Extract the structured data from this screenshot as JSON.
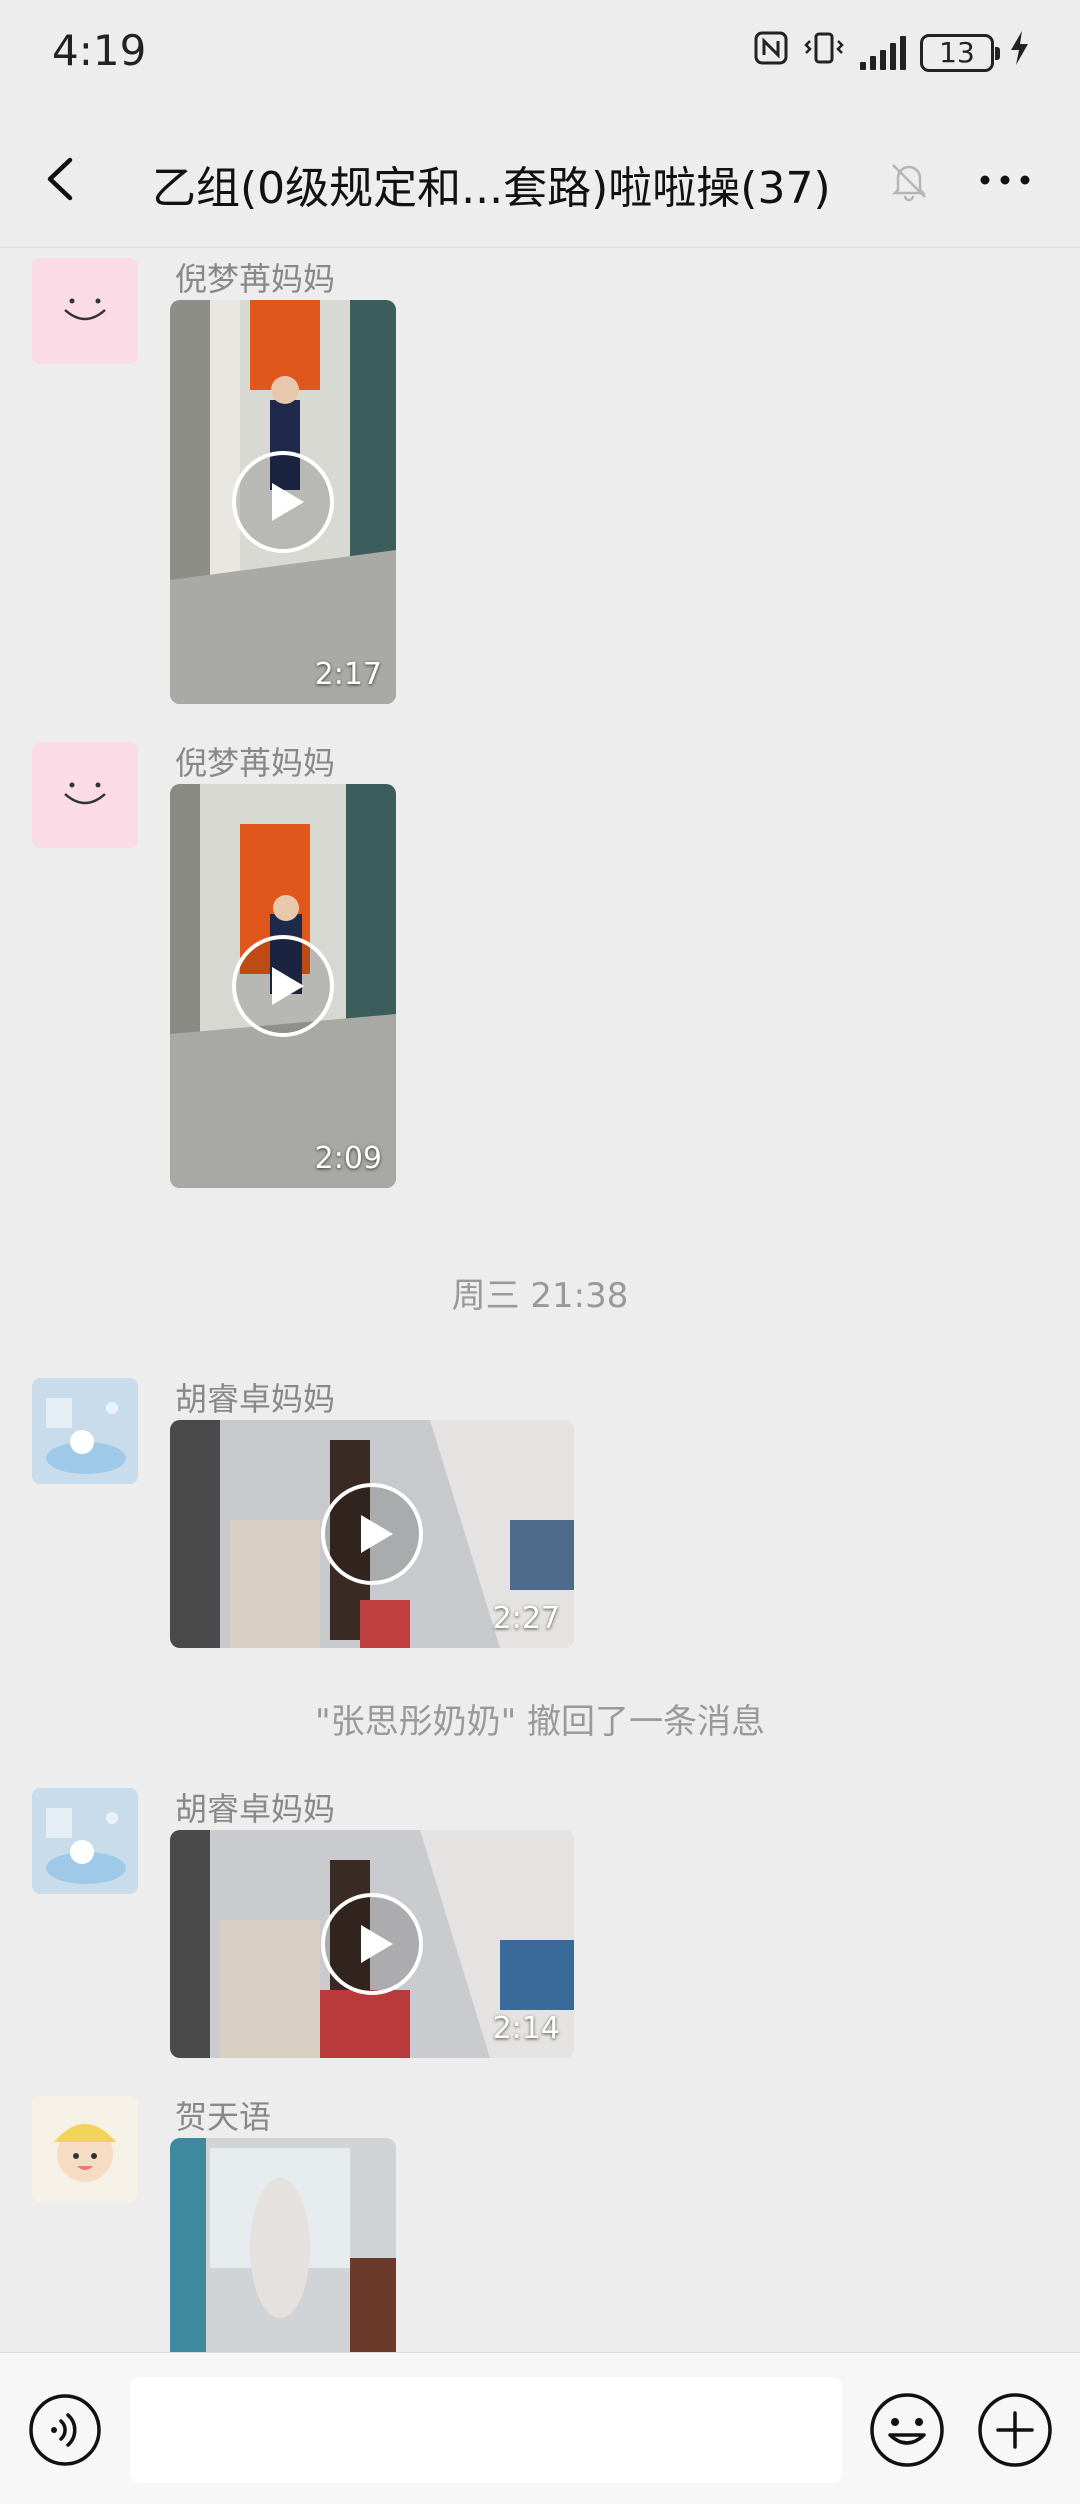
{
  "status_bar": {
    "time": "4:19",
    "battery": "13"
  },
  "header": {
    "title": "乙组(0级规定和...套路)啦啦操(37)"
  },
  "messages": [
    {
      "sender": "倪梦苒妈妈",
      "duration": "2:17"
    },
    {
      "sender": "倪梦苒妈妈",
      "duration": "2:09"
    },
    {
      "timestamp": "周三 21:38"
    },
    {
      "sender": "胡睿卓妈妈",
      "duration": "2:27"
    },
    {
      "system": "\"张思彤奶奶\" 撤回了一条消息"
    },
    {
      "sender": "胡睿卓妈妈",
      "duration": "2:14"
    },
    {
      "sender": "贺天语"
    }
  ],
  "icons": [
    "back-icon",
    "mute-icon",
    "more-icon",
    "play-icon",
    "voice-icon",
    "emoji-icon",
    "plus-icon",
    "nfc-icon",
    "vibrate-icon",
    "signal-icon",
    "battery-icon",
    "charging-icon"
  ],
  "colors": {
    "background": "#ededed",
    "input_bar": "#f7f7f7",
    "secondary_text": "#888888"
  }
}
